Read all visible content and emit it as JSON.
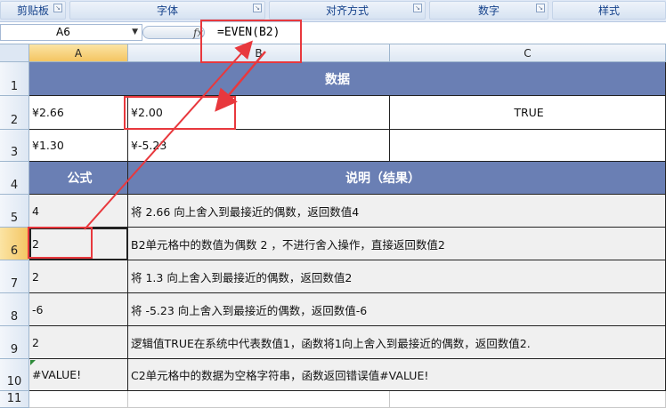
{
  "ribbon": {
    "groups": [
      "剪贴板",
      "字体",
      "对齐方式",
      "数字",
      "样式"
    ]
  },
  "formula_bar": {
    "name_box": "A6",
    "fx_label": "fx",
    "formula": "=EVEN(B2)"
  },
  "columns": [
    "A",
    "B",
    "C"
  ],
  "rows": [
    "1",
    "2",
    "3",
    "4",
    "5",
    "6",
    "7",
    "8",
    "9",
    "10",
    "11"
  ],
  "sheet": {
    "header_data": "数据",
    "data_rows": [
      {
        "a": "¥2.66",
        "b": "¥2.00",
        "c": "TRUE"
      },
      {
        "a": "¥1.30",
        "b": "¥-5.23",
        "c": ""
      }
    ],
    "header_formula": "公式",
    "header_desc": "说明（结果）",
    "results": [
      {
        "a": "4",
        "desc": "将 2.66 向上舍入到最接近的偶数，返回数值4"
      },
      {
        "a": "2",
        "desc": "B2单元格中的数值为偶数 2 ，不进行舍入操作，直接返回数值2"
      },
      {
        "a": "2",
        "desc": "将 1.3 向上舍入到最接近的偶数，返回数值2"
      },
      {
        "a": "-6",
        "desc": "将 -5.23 向上舍入到最接近的偶数，返回数值-6"
      },
      {
        "a": "2",
        "desc": "逻辑值TRUE在系统中代表数值1，函数将1向上舍入到最接近的偶数，返回数值2."
      },
      {
        "a": "#VALUE!",
        "desc": "C2单元格中的数据为空格字符串，函数返回错误值#VALUE!"
      }
    ]
  },
  "colors": {
    "header_fill": "#6a7fb4",
    "annotation": "#e8383d",
    "selected_header": "#f4c562"
  }
}
